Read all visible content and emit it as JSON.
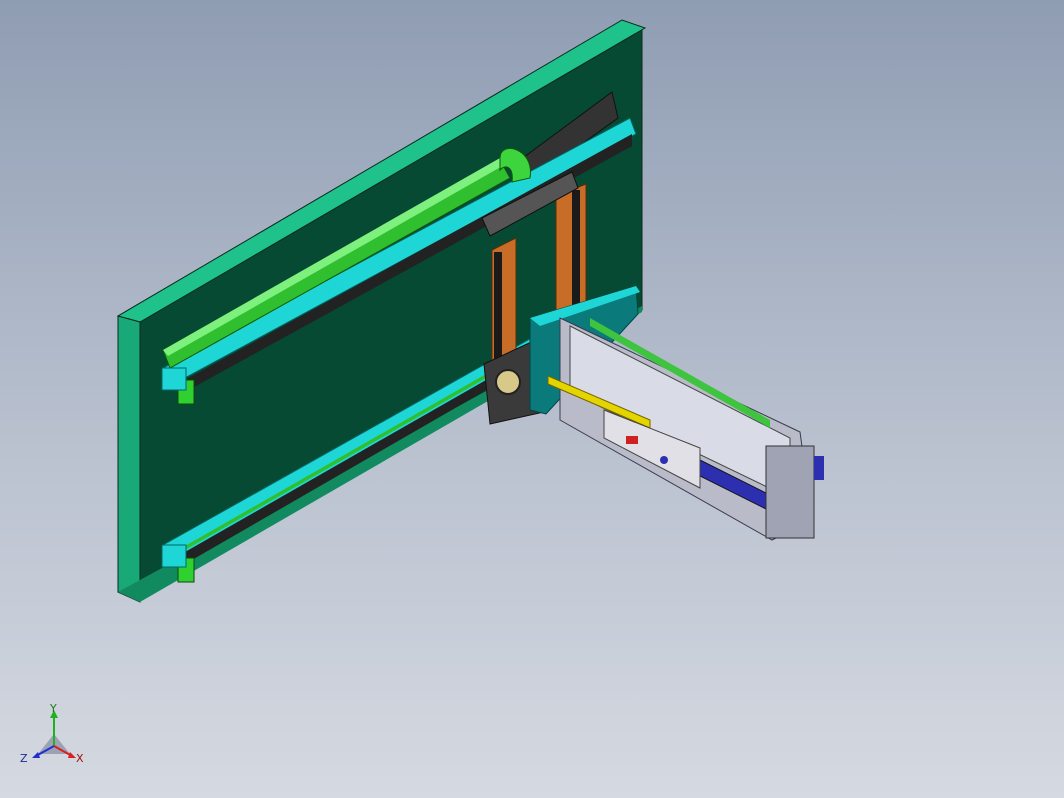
{
  "viewport": {
    "background_top": "#8f9db3",
    "background_bottom": "#d5d9e1"
  },
  "colors": {
    "plate_front": "#064a33",
    "plate_edge": "#1ec28a",
    "rail_cyan": "#1fd6d6",
    "rail_green": "#3ec43e",
    "carriage_orange": "#c86d28",
    "module_blue": "#2b2fb0",
    "module_yellow": "#e4d400",
    "frame_grey": "#c8c8d0"
  },
  "triad": {
    "x_label": "X",
    "y_label": "Y",
    "z_label": "Z",
    "x_color": "#d92020",
    "y_color": "#20b020",
    "z_color": "#2030d0"
  }
}
